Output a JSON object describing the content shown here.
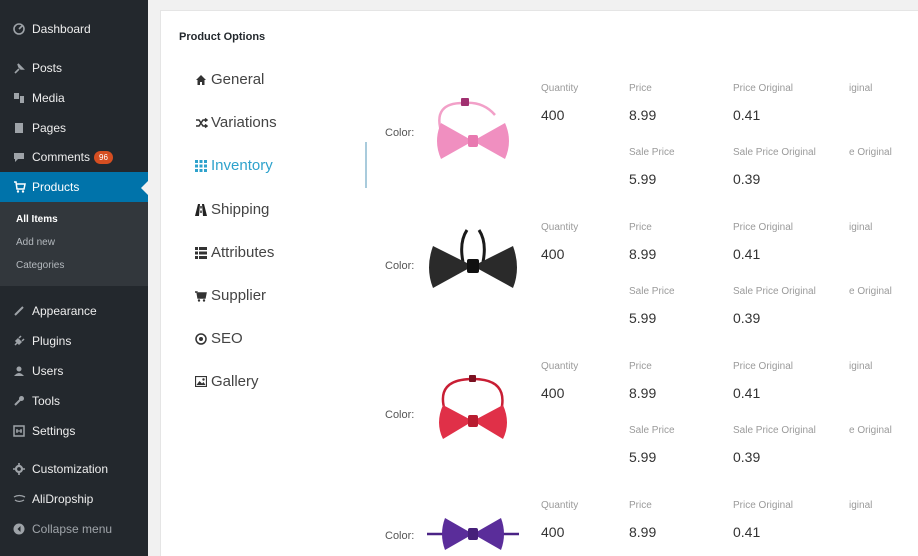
{
  "sidebar": {
    "menu": [
      {
        "label": "Dashboard",
        "icon": "dashboard-icon"
      },
      {
        "label": "Posts",
        "icon": "pin-icon"
      },
      {
        "label": "Media",
        "icon": "media-icon"
      },
      {
        "label": "Pages",
        "icon": "pages-icon"
      },
      {
        "label": "Comments",
        "icon": "comment-icon",
        "badge": "96"
      },
      {
        "label": "Products",
        "icon": "cart-icon"
      },
      {
        "label": "Appearance",
        "icon": "brush-icon"
      },
      {
        "label": "Plugins",
        "icon": "plug-icon"
      },
      {
        "label": "Users",
        "icon": "users-icon"
      },
      {
        "label": "Tools",
        "icon": "wrench-icon"
      },
      {
        "label": "Settings",
        "icon": "settings-icon"
      },
      {
        "label": "Customization",
        "icon": "gear-icon"
      },
      {
        "label": "AliDropship",
        "icon": "aliexpress-icon"
      },
      {
        "label": "Collapse menu",
        "icon": "collapse-icon"
      }
    ],
    "submenu": [
      "All Items",
      "Add new",
      "Categories"
    ]
  },
  "panel": {
    "title": "Product Options",
    "tabs": [
      {
        "label": "General",
        "icon": "home-icon"
      },
      {
        "label": "Variations",
        "icon": "shuffle-icon"
      },
      {
        "label": "Inventory",
        "icon": "grid-icon"
      },
      {
        "label": "Shipping",
        "icon": "road-icon"
      },
      {
        "label": "Attributes",
        "icon": "list-icon"
      },
      {
        "label": "Supplier",
        "icon": "cart-icon"
      },
      {
        "label": "SEO",
        "icon": "target-icon"
      },
      {
        "label": "Gallery",
        "icon": "image-icon"
      }
    ],
    "active_tab": "Inventory"
  },
  "labels": {
    "color": "Color:",
    "quantity": "Quantity",
    "price": "Price",
    "price_original": "Price Original",
    "price_original_cut": "iginal",
    "sale_price": "Sale Price",
    "sale_price_original": "Sale Price Original",
    "sale_price_original_cut": "e Original"
  },
  "variations": [
    {
      "color": "#f08fc0",
      "strap": "#f2a0c8",
      "quantity": "400",
      "price": "8.99",
      "price_original": "0.41",
      "sale_price": "5.99",
      "sale_price_original": "0.39"
    },
    {
      "color": "#2a2a2a",
      "strap": "#1a1a1a",
      "quantity": "400",
      "price": "8.99",
      "price_original": "0.41",
      "sale_price": "5.99",
      "sale_price_original": "0.39"
    },
    {
      "color": "#e03048",
      "strap": "#c81e34",
      "quantity": "400",
      "price": "8.99",
      "price_original": "0.41",
      "sale_price": "5.99",
      "sale_price_original": "0.39"
    },
    {
      "color": "#5a2d9a",
      "strap": "#4a2386",
      "quantity": "400",
      "price": "8.99",
      "price_original": "0.41"
    }
  ]
}
